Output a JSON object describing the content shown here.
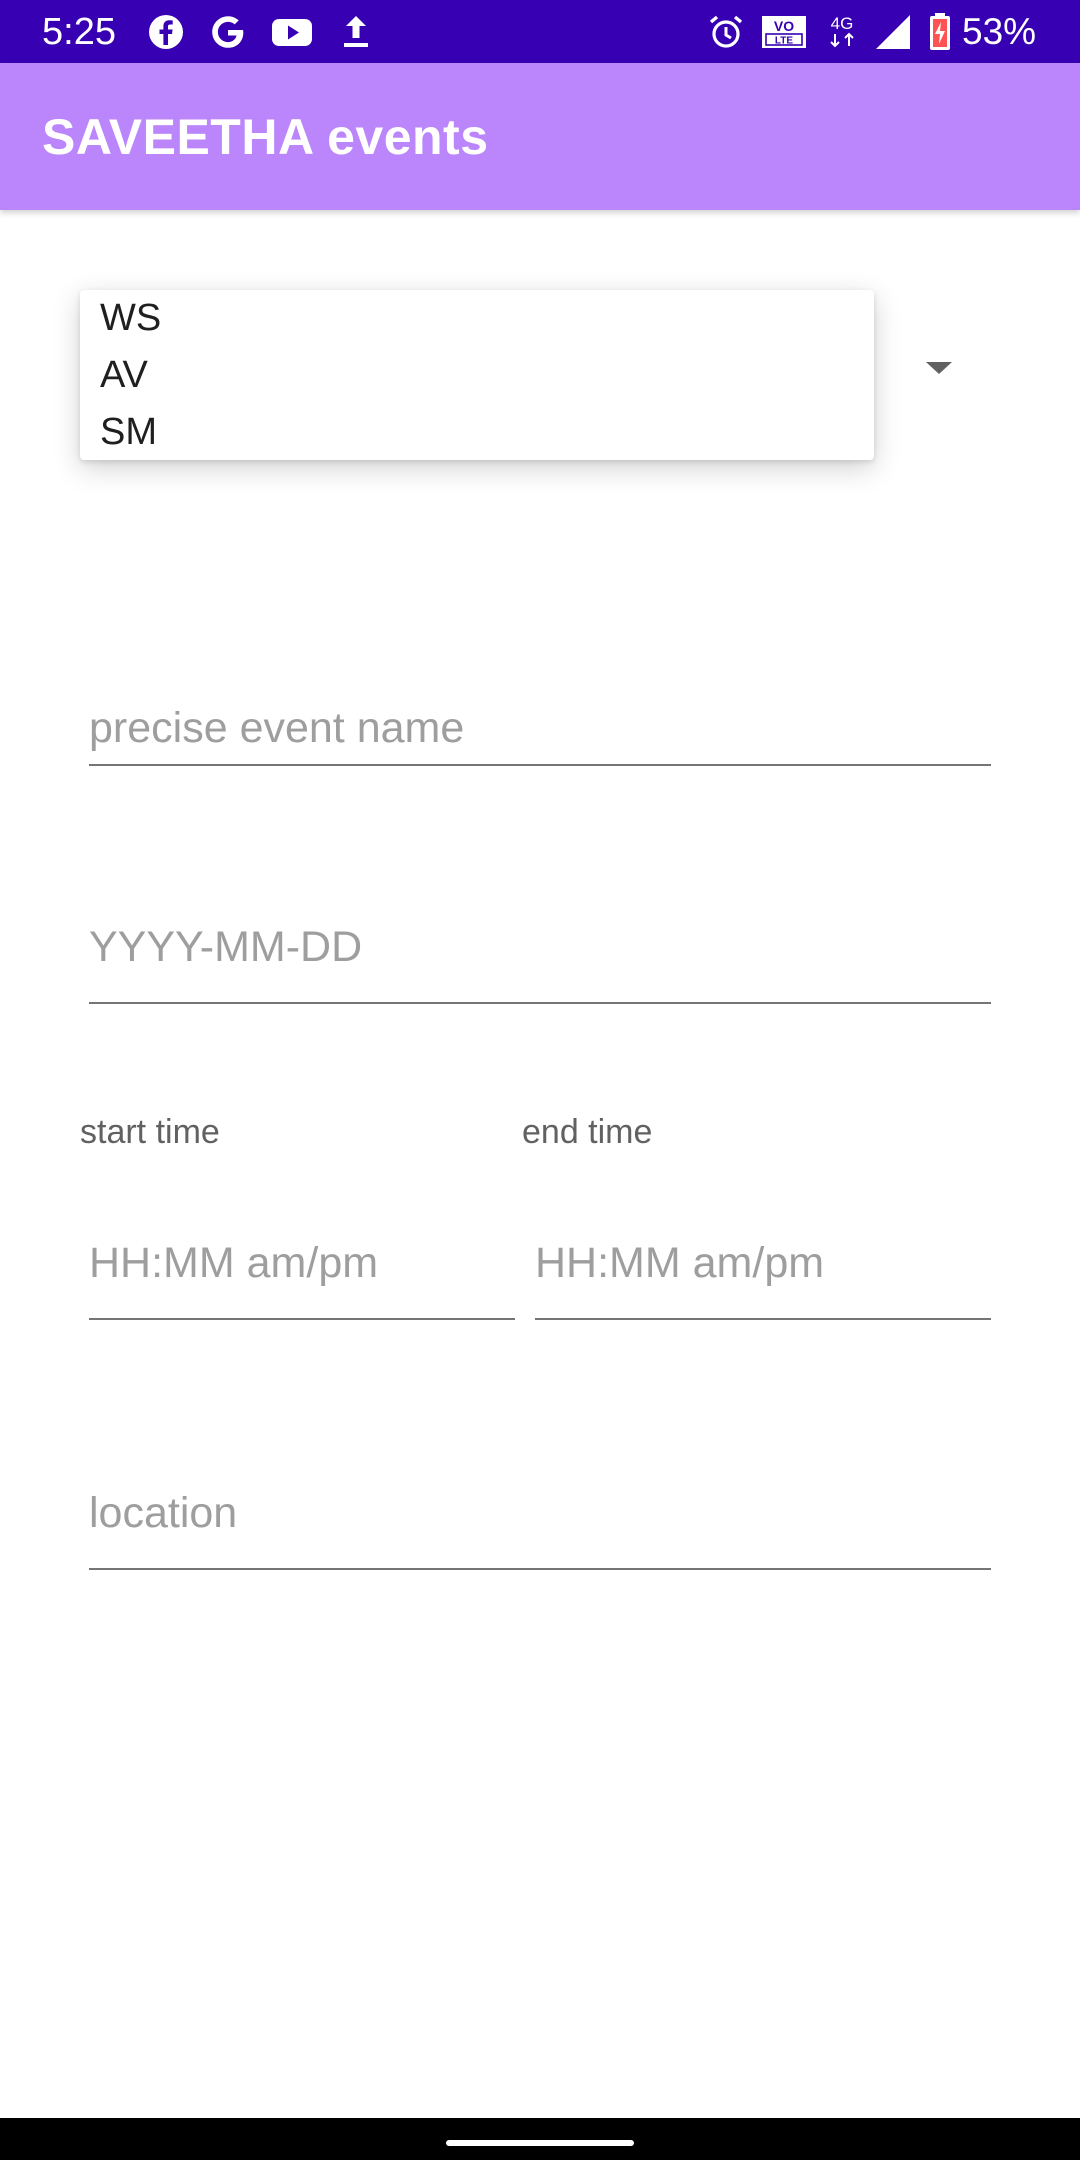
{
  "status_bar": {
    "time": "5:25",
    "battery": "53%",
    "left_icons": [
      "facebook-icon",
      "google-icon",
      "youtube-icon",
      "upload-icon"
    ],
    "right_icons": [
      "alarm-icon",
      "volte-icon",
      "4g-icon",
      "signal-icon",
      "battery-icon"
    ],
    "volte_text": "VO LTE",
    "network_text": "4G",
    "background": "#3700b3"
  },
  "app_bar": {
    "title": "SAVEETHA events",
    "background": "#bb86fc"
  },
  "spinner": {
    "options": [
      "WS",
      "AV",
      "SM"
    ]
  },
  "form": {
    "event_name_placeholder": "precise event name",
    "date_placeholder": "YYYY-MM-DD",
    "start_time_label": "start time",
    "end_time_label": "end time",
    "start_time_placeholder": "HH:MM am/pm",
    "end_time_placeholder": "HH:MM am/pm",
    "location_placeholder": "location"
  }
}
